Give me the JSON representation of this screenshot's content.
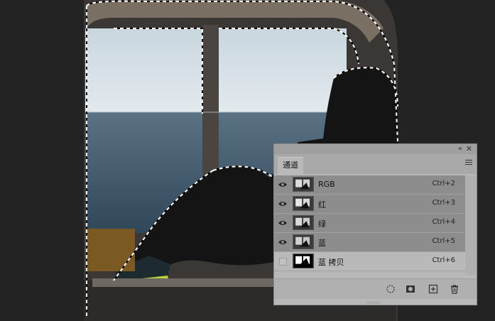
{
  "panel": {
    "collapse_glyph": "«",
    "close_glyph": "✕",
    "tab_label": "通道",
    "menu_icon": "hamburger-menu-icon"
  },
  "channels": [
    {
      "name": "RGB",
      "shortcut": "Ctrl+2",
      "visible": true,
      "selected": true
    },
    {
      "name": "红",
      "shortcut": "Ctrl+3",
      "visible": true,
      "selected": true
    },
    {
      "name": "绿",
      "shortcut": "Ctrl+4",
      "visible": true,
      "selected": true
    },
    {
      "name": "蓝",
      "shortcut": "Ctrl+5",
      "visible": true,
      "selected": true
    },
    {
      "name": "蓝 拷贝",
      "shortcut": "Ctrl+6",
      "visible": false,
      "selected": false
    }
  ],
  "footer": {
    "icons": [
      "load-selection-icon",
      "save-selection-mask-icon",
      "new-channel-icon",
      "delete-channel-icon"
    ]
  }
}
